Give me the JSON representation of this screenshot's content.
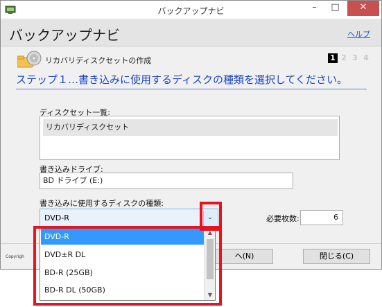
{
  "window": {
    "title": "バックアップナビ",
    "minimize_glyph": "–",
    "maximize_glyph": "□",
    "close_glyph": "✕"
  },
  "header": {
    "app_title": "バックアップナビ",
    "help_link": "ヘルプ"
  },
  "section": {
    "title": "リカバリディスクセットの作成",
    "steps": [
      "1",
      "2",
      "3",
      "4"
    ],
    "active_step": "1"
  },
  "step_heading": "ステップ１…書き込みに使用するディスクの種類を選択してください。",
  "diskset": {
    "label": "ディスクセット一覧:",
    "items": [
      "リカバリディスクセット"
    ]
  },
  "drive": {
    "label": "書き込みドライブ:",
    "value": "BD ドライブ (E:)"
  },
  "disc_type": {
    "label": "書き込みに使用するディスクの種類:",
    "selected": "DVD-R",
    "arrow_glyph": "⌄",
    "options": [
      "DVD-R",
      "DVD±R DL",
      "BD-R (25GB)",
      "BD-R DL (50GB)"
    ]
  },
  "required_count": {
    "label": "必要枚数:",
    "value": "6"
  },
  "footer": {
    "copyright": "Copyrigh",
    "next_button": "次へ(N)",
    "next_button_visible": "へ(N)",
    "close_button": "閉じる(C)"
  },
  "scrollbar": {
    "up_glyph": "▲",
    "down_glyph": "▼"
  },
  "colors": {
    "accent_heading": "#1c46c8",
    "highlight": "#3399ff",
    "annotation": "#e8131f",
    "close_button": "#c75050"
  }
}
